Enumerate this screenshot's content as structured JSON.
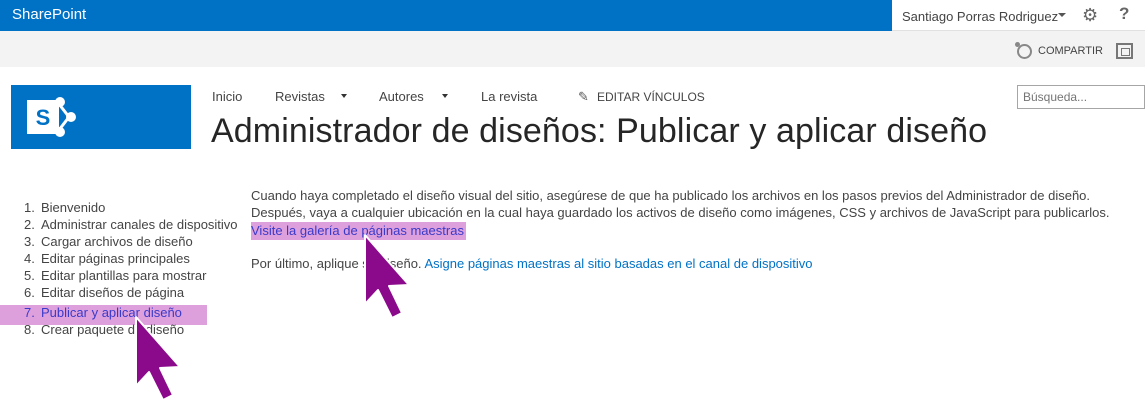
{
  "suite": {
    "brand": "SharePoint",
    "user": "Santiago Porras Rodriguez",
    "help": "?"
  },
  "actions": {
    "share": "COMPARTIR"
  },
  "nav": {
    "items": [
      {
        "label": "Inicio",
        "dropdown": false
      },
      {
        "label": "Revistas",
        "dropdown": true
      },
      {
        "label": "Autores",
        "dropdown": true
      },
      {
        "label": "La revista",
        "dropdown": false
      }
    ],
    "edit_links": "EDITAR VÍNCULOS"
  },
  "search": {
    "placeholder": "Búsqueda..."
  },
  "page": {
    "title": "Administrador de diseños: Publicar y aplicar diseño"
  },
  "steps": [
    {
      "num": "1.",
      "label": "Bienvenido"
    },
    {
      "num": "2.",
      "label": "Administrar canales de dispositivo"
    },
    {
      "num": "3.",
      "label": "Cargar archivos de diseño"
    },
    {
      "num": "4.",
      "label": "Editar páginas principales"
    },
    {
      "num": "5.",
      "label": "Editar plantillas para mostrar"
    },
    {
      "num": "6.",
      "label": "Editar diseños de página"
    },
    {
      "num": "7.",
      "label": "Publicar y aplicar diseño"
    },
    {
      "num": "8.",
      "label": "Crear paquete de diseño"
    }
  ],
  "current_step": 7,
  "content": {
    "line1": "Cuando haya completado el diseño visual del sitio, asegúrese de que ha publicado los archivos en los pasos previos del Administrador de diseño.",
    "line2": "Después, vaya a cualquier ubicación en la cual haya guardado los activos de diseño como imágenes, CSS y archivos de JavaScript para publicarlos.",
    "gallery_link": "Visite la galería de páginas maestras",
    "apply_prefix": "Por último, aplique su diseño.",
    "apply_link": "Asigne páginas maestras al sitio basadas en el canal de dispositivo"
  },
  "colors": {
    "suite_bar": "#0072c6",
    "highlight": "#dda0dd",
    "cursor": "#8b0a8b",
    "link": "#0072c6"
  }
}
